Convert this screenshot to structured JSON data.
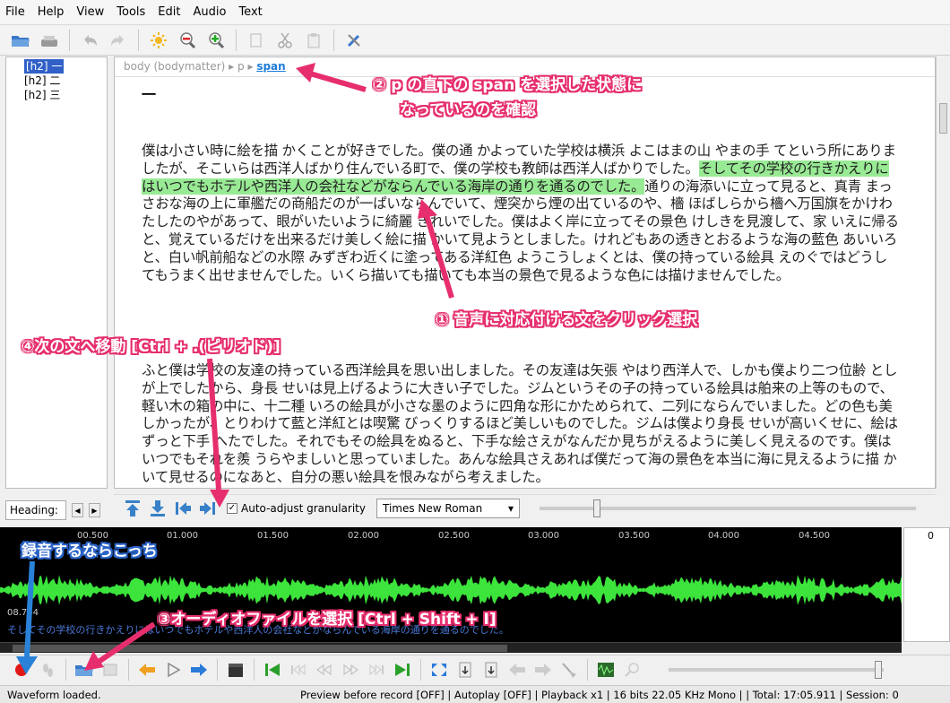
{
  "menu": [
    "File",
    "Help",
    "View",
    "Tools",
    "Edit",
    "Audio",
    "Text"
  ],
  "sidebar": {
    "items": [
      {
        "label": "[h2] 一"
      },
      {
        "label": "[h2] 二"
      },
      {
        "label": "[h2] 三"
      }
    ],
    "tab_label": "Heading:",
    "tab_prev": "◀",
    "tab_next": "▶"
  },
  "breadcrumb": {
    "a": "body (bodymatter)",
    "sep": "▸",
    "b": "p",
    "c": "span"
  },
  "doc": {
    "heading": "一",
    "p1_before": "僕は小さい時に絵を描 かくことが好きでした。僕の通 かよっていた学校は横浜 よこはまの山 やまの手 てという所にありましたが、そこいらは西洋人ばかり住んでいる町で、僕の学校も教師は西洋人ばかりでした。",
    "p1_highlight": "そしてその学校の行きかえりにはいつでもホテルや西洋人の会社などがならんでいる海岸の通りを通るのでした。",
    "p1_after": "通りの海添いに立って見ると、真青 まっさおな海の上に軍艦だの商船だのが一ぱいならんでいて、煙突から煙の出ているのや、檣 ほばしらから檣へ万国旗をかけわたしたのやがあって、眼がいたいように綺麗 きれいでした。僕はよく岸に立ってその景色 けしきを見渡して、家 いえに帰ると、覚えているだけを出来るだけ美しく絵に描 かいて見ようとしました。けれどもあの透きとおるような海の藍色 あいいろと、白い帆前船などの水際 みずぎわ近くに塗ってある洋紅色 ようこうしょくとは、僕の持っている絵具 えのぐではどうしてもうまく出せませんでした。いくら描いても描いても本当の景色で見るような色には描けませんでした。",
    "p2": "ふと僕は学校の友達の持っている西洋絵具を思い出しました。その友達は矢張 やはり西洋人で、しかも僕より二つ位齢 としが上でしたから、身長 せいは見上げるように大きい子でした。ジムというその子の持っている絵具は舶来の上等のもので、軽い木の箱の中に、十二種 いろの絵具が小さな墨のように四角な形にかためられて、二列にならんでいました。どの色も美しかったが、とりわけて藍と洋紅とは喫驚 びっくりするほど美しいものでした。ジムは僕より身長 せいが高いくせに、絵はずっと下手 へたでした。それでもその絵具をぬると、下手な絵さえがなんだか見ちがえるように美しく見えるのです。僕はいつでもそれを羨 うらやましいと思っていました。あんな絵具さえあれば僕だって海の景色を本当に海に見えるように描 かいて見せるのになあと、自分の悪い絵具を恨みながら考えました。"
  },
  "navbar": {
    "auto_adjust": "Auto-adjust granularity",
    "checkbox": "✓",
    "font": "Times New Roman",
    "font_arrow": "▾"
  },
  "waveform": {
    "ticks": [
      "00.500",
      "01.000",
      "01.500",
      "02.000",
      "02.500",
      "03.000",
      "03.500",
      "04.000",
      "04.500"
    ],
    "timestamp": "08.744",
    "subtitle": "そしてその学校の行きかえりにはいつでもホテルや西洋人の会社などがならんでいる海岸の通りを通るのでした。",
    "right_number": "0",
    "color": "#3ce43c"
  },
  "status": {
    "left": "Waveform loaded.",
    "right": "Preview before record [OFF] | Autoplay [OFF] | Playback x1 | 16 bits 22.05 KHz Mono | | Total: 17:05.911 | Session: 0"
  },
  "annotations": {
    "c1": "① 音声に対応付ける文をクリック選択",
    "c2a": "② p の直下の span を選択した状態に",
    "c2b": "なっているのを確認",
    "c3": "③オーディオファイルを選択 [Ctrl + Shift + I]",
    "c4": "④次の文へ移動 [Ctrl + .(ピリオド)]",
    "c5": "録音するならこっち",
    "arrow_pink": "#e62e6e",
    "arrow_blue": "#2a82d8"
  },
  "icons": {
    "toolbar": [
      "open-folder-icon",
      "save-icon",
      "undo-icon",
      "redo-icon",
      "sun-icon",
      "zoom-out-icon",
      "zoom-in-icon",
      "copy-icon",
      "cut-icon",
      "paste-icon",
      "tools-icon"
    ],
    "audiobar": [
      "record-icon",
      "footstep-icon",
      "open-audio-icon",
      "image-icon",
      "back-icon",
      "play-icon",
      "forward-icon",
      "clapper-icon",
      "first-icon",
      "prev-icon",
      "rewind-icon",
      "fastforward-icon",
      "next-icon",
      "last-icon",
      "expand-icon",
      "insert-icon",
      "insert-after-icon",
      "left-icon",
      "right-icon",
      "broom-icon",
      "wave-icon",
      "search-icon"
    ]
  }
}
